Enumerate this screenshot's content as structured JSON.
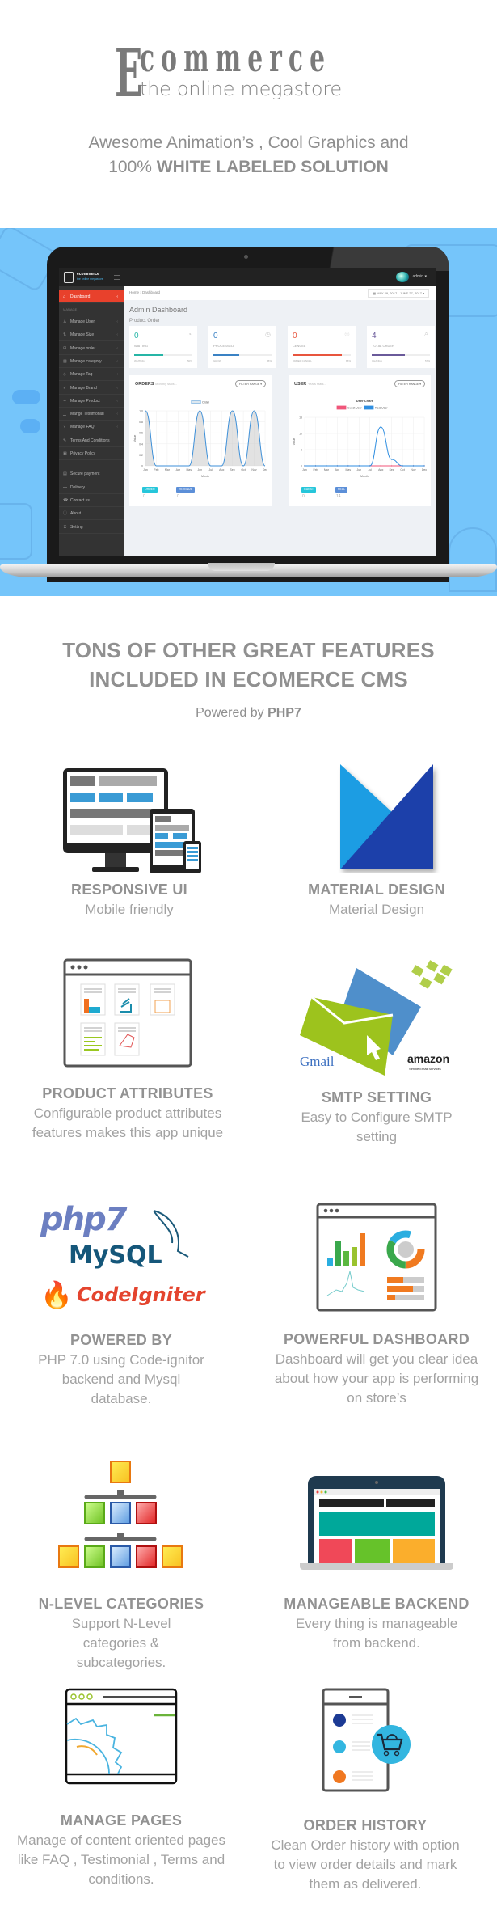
{
  "brand": {
    "logo_initial": "E",
    "logo_word": "commerce",
    "logo_tagline": "the online megastore"
  },
  "tagline": {
    "line1": "Awesome Animation’s , Cool Graphics and",
    "line2_prefix": "100% ",
    "line2_bold": "WHITE LABELED SOLUTION"
  },
  "dashboard": {
    "logo_text": "ecommerce",
    "logo_sub": "the online megastore",
    "user": "admin ▾",
    "breadcrumb": "Home  ›  Dashboard",
    "date_range": "▦ MAY 29, 2017 - JUNE 27, 2017 ▾",
    "title": "Admin Dashboard",
    "subtitle": "Product Order",
    "sidebar": {
      "active": "Dashboard",
      "section_label": "MANAGE",
      "items": [
        {
          "label": "Manage User",
          "icon": "user-icon",
          "glyph": "♙"
        },
        {
          "label": "Manage Size",
          "icon": "size-icon",
          "glyph": "⇅"
        },
        {
          "label": "Manage order",
          "icon": "cart-icon",
          "glyph": "⊞"
        },
        {
          "label": "Manage category",
          "icon": "grid-icon",
          "glyph": "▦"
        },
        {
          "label": "Manage Tag",
          "icon": "tag-icon",
          "glyph": "◇"
        },
        {
          "label": "Manage Brand",
          "icon": "check-icon",
          "glyph": "✓"
        },
        {
          "label": "Manage Product",
          "icon": "trend-icon",
          "glyph": "∼"
        },
        {
          "label": "Mange Testimonial",
          "icon": "bar-icon",
          "glyph": "▁"
        },
        {
          "label": "Manage FAQ",
          "icon": "question-icon",
          "glyph": "?"
        },
        {
          "label": "Terms And Conditions",
          "icon": "pencil-icon",
          "glyph": "✎"
        },
        {
          "label": "Privacy Policy",
          "icon": "lock-icon",
          "glyph": "▣"
        },
        {
          "label": "Secure payment",
          "icon": "card-icon",
          "glyph": "▤"
        },
        {
          "label": "Delivery",
          "icon": "truck-icon",
          "glyph": "▬"
        },
        {
          "label": "Contact us",
          "icon": "phone-icon",
          "glyph": "☎"
        },
        {
          "label": "About",
          "icon": "info-icon",
          "glyph": "ⓘ"
        },
        {
          "label": "Setting",
          "icon": "wrench-icon",
          "glyph": "⚒"
        }
      ]
    },
    "stats": [
      {
        "value": "0",
        "label": "WAITING",
        "foot": "WAITING",
        "pct": "50%",
        "progress": 0.5,
        "color": "#26b5a6",
        "icon": "clock-icon",
        "glyph": "◔"
      },
      {
        "value": "0",
        "label": "PROCESSED",
        "foot": "GROW",
        "pct": "45%",
        "progress": 0.45,
        "color": "#3a82c4",
        "icon": "gauge-icon",
        "glyph": "◷"
      },
      {
        "value": "0",
        "label": "CENCEL",
        "foot": "ORDER CANCEL",
        "pct": "85%",
        "progress": 0.85,
        "color": "#e8553e",
        "icon": "cancel-user-icon",
        "glyph": "♲"
      },
      {
        "value": "4",
        "label": "TOTAL ORDER",
        "foot": "CHANGE",
        "pct": "57%",
        "progress": 0.57,
        "color": "#6a5a9a",
        "icon": "user-icon",
        "glyph": "♙"
      }
    ],
    "orders_panel": {
      "title": "ORDERS",
      "subtitle": "Monthly stats...",
      "filter": "FILTER RANGE ▾",
      "badges": [
        {
          "label": "ORDER",
          "value": "0",
          "color": "#26c6da"
        },
        {
          "label": "REVENUE",
          "value": "0",
          "color": "#5c8fd8"
        }
      ]
    },
    "user_panel": {
      "title": "USER",
      "subtitle": "Years stats...",
      "filter": "FILTER RANGE ▾",
      "badges": [
        {
          "label": "GUEST",
          "value": "0",
          "color": "#26c6da"
        },
        {
          "label": "REAL",
          "value": "14",
          "color": "#5c8fd8"
        }
      ]
    }
  },
  "chart_data": [
    {
      "type": "area",
      "title": "",
      "xlabel": "Month",
      "ylabel": "Value",
      "categories": [
        "Jan",
        "Feb",
        "Mar",
        "Apr",
        "May",
        "Jun",
        "Jul",
        "Aug",
        "Sep",
        "Oct",
        "Nov",
        "Dec"
      ],
      "ylim": [
        0,
        1.0
      ],
      "yticks": [
        "1.0",
        "0.8",
        "0.6",
        "0.4",
        "0.2",
        "0"
      ],
      "legend": "top",
      "grid": true,
      "series": [
        {
          "name": "Order",
          "color": "#3d8fd8",
          "values": [
            1,
            0,
            0,
            0,
            0,
            1,
            0,
            0,
            1,
            0,
            1,
            0
          ]
        }
      ]
    },
    {
      "type": "line",
      "title": "User Chart",
      "xlabel": "Month",
      "ylabel": "Value",
      "categories": [
        "Jan",
        "Feb",
        "Mar",
        "Apr",
        "May",
        "Jun",
        "Jul",
        "Aug",
        "Sep",
        "Oct",
        "Nov",
        "Dec"
      ],
      "ylim": [
        0,
        15
      ],
      "yticks": [
        "15",
        "10",
        "5",
        "0"
      ],
      "legend": "top",
      "grid": true,
      "series": [
        {
          "name": "Guest User",
          "color": "#f0567a",
          "values": [
            0,
            0,
            0,
            0,
            0,
            0,
            0,
            0,
            0,
            0,
            0,
            0
          ]
        },
        {
          "name": "Real User",
          "color": "#2f8ee0",
          "values": [
            0,
            0,
            0,
            0,
            0,
            0,
            0,
            12,
            2,
            0,
            0,
            0
          ]
        }
      ]
    }
  ],
  "features": {
    "title_line1": "TONS OF OTHER GREAT FEATURES",
    "title_line2": "INCLUDED IN ECOMERCE CMS",
    "powered_prefix": "Powered by ",
    "powered_bold": "PHP7",
    "items": [
      {
        "title": "RESPONSIVE UI",
        "desc": "Mobile friendly",
        "icon": "responsive-devices-icon"
      },
      {
        "title": "MATERIAL DESIGN",
        "desc": "Material Design",
        "icon": "material-m-icon"
      },
      {
        "title": "PRODUCT ATTRIBUTES",
        "desc": "Configurable product attributes features makes this app unique",
        "icon": "product-attributes-icon"
      },
      {
        "title": "SMTP SETTING",
        "desc": "Easy to Configure SMTP setting",
        "icon": "email-envelope-icon",
        "logos": [
          "Gmail",
          "amazon",
          "Simple Email Services"
        ]
      },
      {
        "title": "POWERED BY",
        "desc": "PHP 7.0 using Code-ignitor backend and Mysql database.",
        "icon": "tech-stack-icon",
        "logos": [
          "php7",
          "MySQL",
          "CodeIgniter"
        ]
      },
      {
        "title": "POWERFUL DASHBOARD",
        "desc": "Dashboard will get you clear idea about how your app is performing on store’s",
        "icon": "dashboard-analytics-icon"
      },
      {
        "title": "N-LEVEL CATEGORIES",
        "desc": "Support N-Level categories & subcategories.",
        "icon": "category-tree-icon"
      },
      {
        "title": "MANAGEABLE BACKEND",
        "desc": "Every thing is manageable from backend.",
        "icon": "laptop-backend-icon"
      },
      {
        "title": "MANAGE PAGES",
        "desc": "Manage of content oriented pages like FAQ , Testimonial , Terms and conditions.",
        "icon": "gear-window-icon"
      },
      {
        "title": "ORDER HISTORY",
        "desc": "Clean Order history with option to view order details and mark them as delivered.",
        "icon": "order-phone-cart-icon"
      }
    ]
  }
}
